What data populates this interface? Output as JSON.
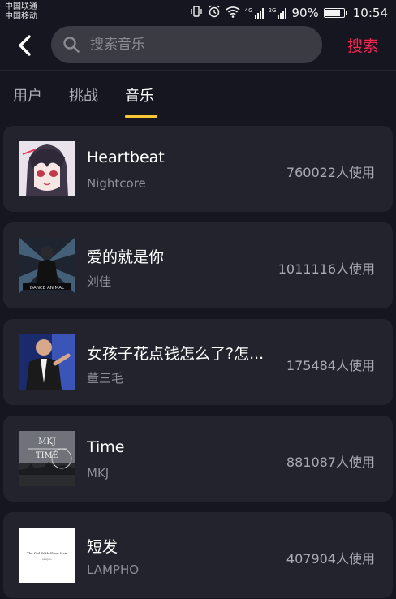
{
  "status_bar": {
    "carrier1": "中国联通",
    "carrier2": "中国移动",
    "signal1_tag": "4G",
    "signal2_tag": "2G",
    "battery": "90%",
    "battery_level": 0.9,
    "time": "10:54"
  },
  "header": {
    "back_icon": "chevron-left-icon",
    "search_placeholder": "搜索音乐",
    "search_label": "搜索",
    "accent_color": "#f0264f"
  },
  "tabs": [
    {
      "label": "用户",
      "active": false
    },
    {
      "label": "挑战",
      "active": false
    },
    {
      "label": "音乐",
      "active": true
    }
  ],
  "tab_indicator_color": "#f8c537",
  "songs": [
    {
      "title": "Heartbeat",
      "artist": "Nightcore",
      "usage": "760022人使用"
    },
    {
      "title": "爱的就是你",
      "artist": "刘佳",
      "usage": "1011116人使用"
    },
    {
      "title": "女孩子花点钱怎么了?怎...",
      "artist": "董三毛",
      "usage": "175484人使用"
    },
    {
      "title": "Time",
      "artist": "MKJ",
      "usage": "881087人使用",
      "cover_text1": "MKJ",
      "cover_text2": "TIME"
    },
    {
      "title": "短发",
      "artist": "LAMPHO",
      "usage": "407904人使用",
      "cover_text1": "The Girl With Short Hair",
      "cover_text2": "lampho"
    }
  ]
}
